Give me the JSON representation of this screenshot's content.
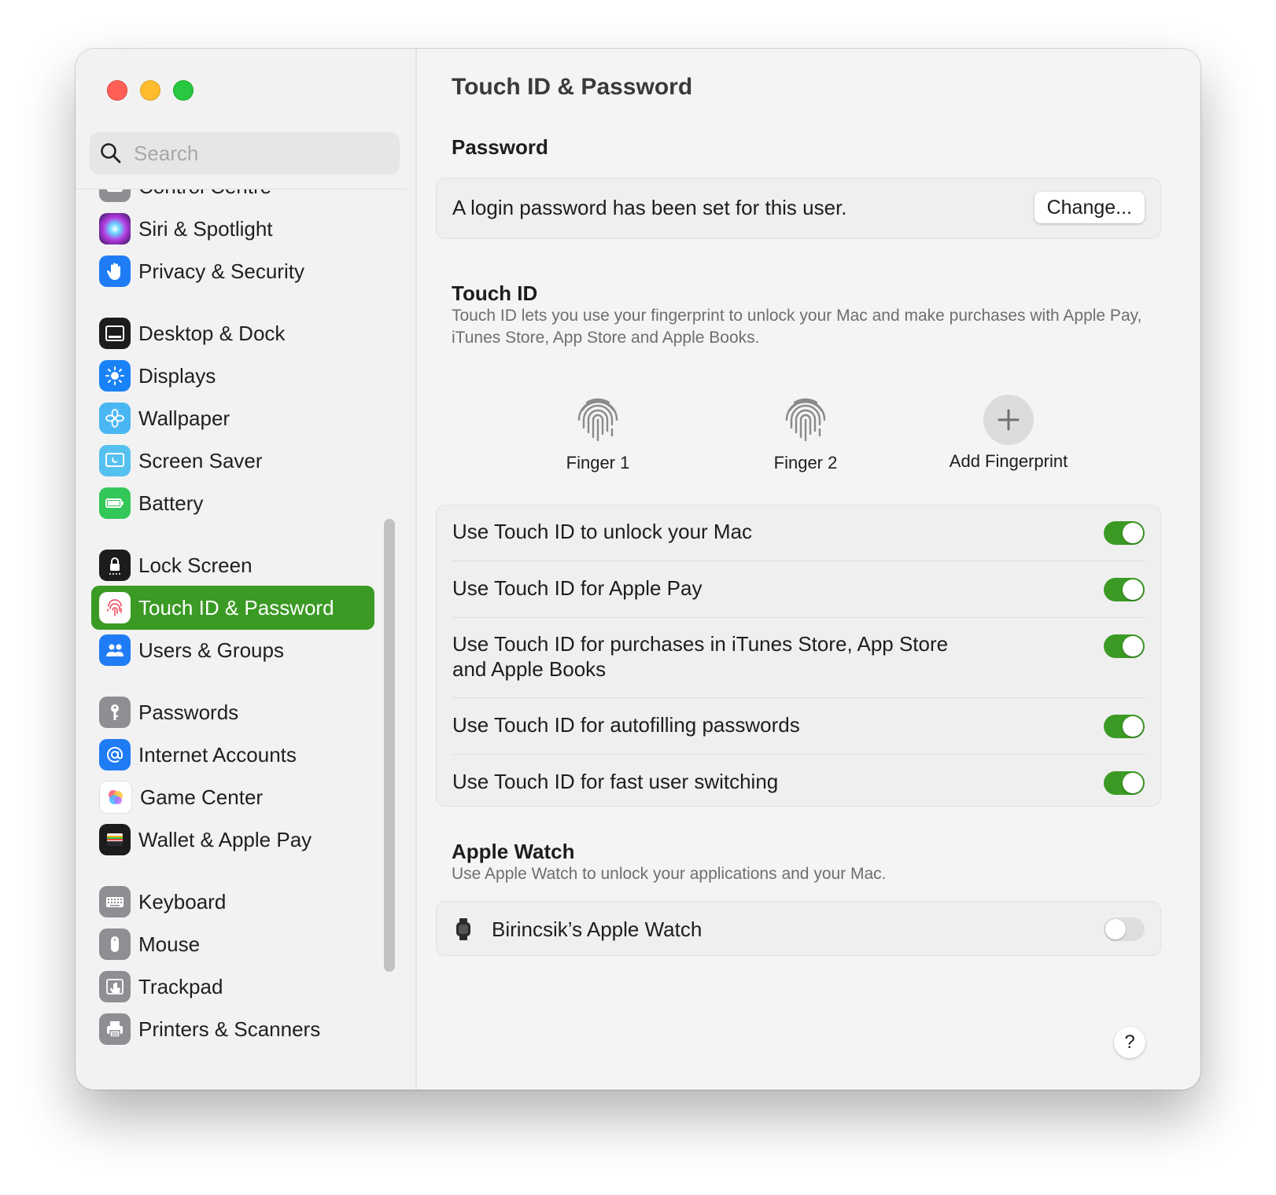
{
  "window": {
    "title": "Touch ID & Password"
  },
  "sidebar": {
    "search_placeholder": "Search",
    "items": [
      {
        "label": "Control Centre",
        "icon": "control-centre-icon",
        "color": "#8e8e93"
      },
      {
        "label": "Siri & Spotlight",
        "icon": "siri-icon",
        "color": "#6a3ad1"
      },
      {
        "label": "Privacy & Security",
        "icon": "hand-icon",
        "color": "#1f7cf5"
      },
      {
        "label": "Desktop & Dock",
        "icon": "dock-icon",
        "color": "#1c1c1e"
      },
      {
        "label": "Displays",
        "icon": "sun-icon",
        "color": "#1a82f7"
      },
      {
        "label": "Wallpaper",
        "icon": "flower-icon",
        "color": "#49b7f3"
      },
      {
        "label": "Screen Saver",
        "icon": "screen-saver-icon",
        "color": "#55c1f0"
      },
      {
        "label": "Battery",
        "icon": "battery-icon",
        "color": "#33c759"
      },
      {
        "label": "Lock Screen",
        "icon": "lock-icon",
        "color": "#1c1c1e"
      },
      {
        "label": "Touch ID & Password",
        "icon": "fingerprint-icon",
        "color": "#ffffff",
        "selected": true
      },
      {
        "label": "Users & Groups",
        "icon": "users-icon",
        "color": "#1f7cf5"
      },
      {
        "label": "Passwords",
        "icon": "key-icon",
        "color": "#8e8e93"
      },
      {
        "label": "Internet Accounts",
        "icon": "at-icon",
        "color": "#1f7cf5"
      },
      {
        "label": "Game Center",
        "icon": "game-center-icon",
        "color": "#ffffff"
      },
      {
        "label": "Wallet & Apple Pay",
        "icon": "wallet-icon",
        "color": "#1c1c1e"
      },
      {
        "label": "Keyboard",
        "icon": "keyboard-icon",
        "color": "#8e8e93"
      },
      {
        "label": "Mouse",
        "icon": "mouse-icon",
        "color": "#8e8e93"
      },
      {
        "label": "Trackpad",
        "icon": "trackpad-icon",
        "color": "#8e8e93"
      },
      {
        "label": "Printers & Scanners",
        "icon": "printer-icon",
        "color": "#8e8e93"
      }
    ]
  },
  "main": {
    "title": "Touch ID & Password",
    "password": {
      "heading": "Password",
      "status": "A login password has been set for this user.",
      "change_button": "Change..."
    },
    "touch_id": {
      "heading": "Touch ID",
      "description": "Touch ID lets you use your fingerprint to unlock your Mac and make purchases with Apple Pay, iTunes Store, App Store and Apple Books.",
      "fingerprints": [
        "Finger 1",
        "Finger 2"
      ],
      "add_label": "Add Fingerprint",
      "options": [
        {
          "label": "Use Touch ID to unlock your Mac",
          "on": true
        },
        {
          "label": "Use Touch ID for Apple Pay",
          "on": true
        },
        {
          "label": "Use Touch ID for purchases in iTunes Store, App Store and Apple Books",
          "on": true
        },
        {
          "label": "Use Touch ID for autofilling passwords",
          "on": true
        },
        {
          "label": "Use Touch ID for fast user switching",
          "on": true
        }
      ]
    },
    "apple_watch": {
      "heading": "Apple Watch",
      "description": "Use Apple Watch to unlock your applications and your Mac.",
      "watch_name": "Birincsik’s Apple Watch",
      "on": false
    },
    "help_label": "?"
  },
  "colors": {
    "accent": "#3b9a24",
    "toggle_off": "#dedede"
  }
}
